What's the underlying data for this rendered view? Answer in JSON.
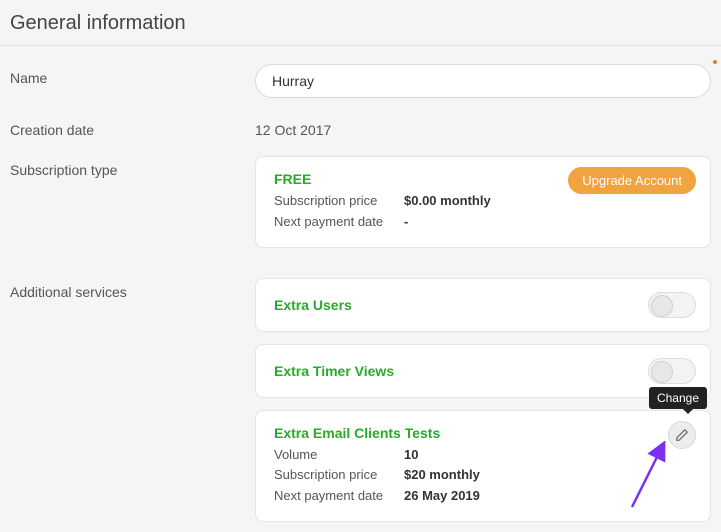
{
  "section_title": "General information",
  "labels": {
    "name": "Name",
    "creation_date": "Creation date",
    "subscription_type": "Subscription type",
    "additional_services": "Additional services"
  },
  "name_value": "Hurray",
  "creation_date_value": "12 Oct 2017",
  "subscription": {
    "plan": "FREE",
    "price_label": "Subscription price",
    "price_value": "$0.00 monthly",
    "next_label": "Next payment date",
    "next_value": "-",
    "upgrade_label": "Upgrade Account"
  },
  "services": {
    "extra_users": {
      "title": "Extra Users"
    },
    "extra_timer": {
      "title": "Extra Timer Views"
    },
    "extra_email": {
      "title": "Extra Email Clients Tests",
      "volume_label": "Volume",
      "volume_value": "10",
      "price_label": "Subscription price",
      "price_value": "$20 monthly",
      "next_label": "Next payment date",
      "next_value": "26 May 2019",
      "tooltip": "Change"
    }
  },
  "colors": {
    "accent_green": "#2aa92a",
    "accent_orange": "#f0a33e",
    "arrow_purple": "#7b2ff2"
  }
}
